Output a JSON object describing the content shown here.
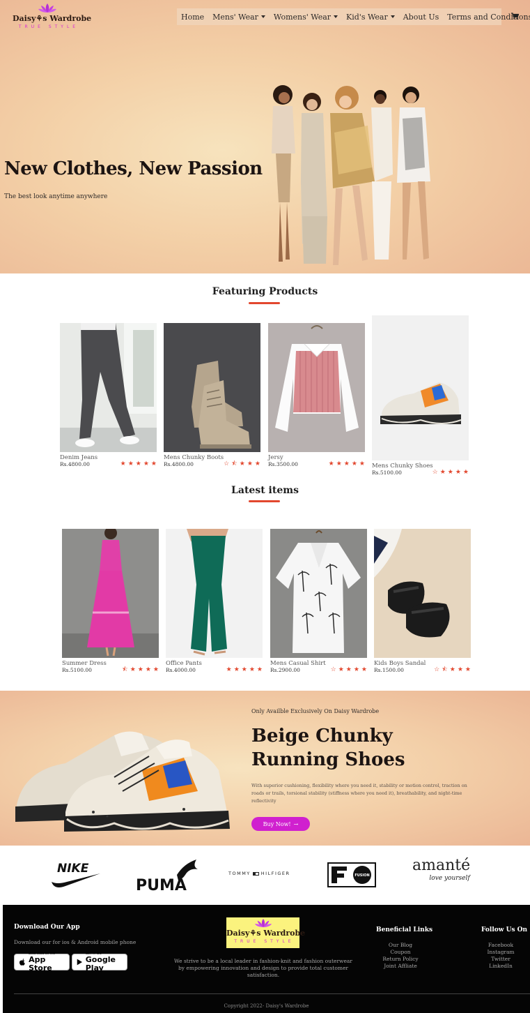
{
  "header": {
    "brand": "Daisy⚘s Wardrobe",
    "tagline": "TRUE STYLE",
    "nav": [
      {
        "label": "Home"
      },
      {
        "label": "Mens' Wear"
      },
      {
        "label": "Womens' Wear"
      },
      {
        "label": "Kid's Wear"
      },
      {
        "label": "About Us"
      },
      {
        "label": "Terms and Conditions"
      }
    ],
    "cart_icon": "cart-icon"
  },
  "hero": {
    "title": "New Clothes, New Passion",
    "subtitle": "The best look anytime anywhere"
  },
  "featuring": {
    "title": "Featuring Products",
    "items": [
      {
        "name": "Denim Jeans",
        "price": "Rs.4800.00",
        "rating": 5
      },
      {
        "name": "Mens Chunky Boots",
        "price": "Rs.4800.00",
        "rating": 3.5
      },
      {
        "name": "Jersy",
        "price": "Rs.3500.00",
        "rating": 5
      },
      {
        "name": "Mens Chunky Shoes",
        "price": "Rs.5100.00",
        "rating": 4
      }
    ]
  },
  "latest": {
    "title": "Latest items",
    "items": [
      {
        "name": "Summer Dress",
        "price": "Rs.5100.00",
        "rating": 4.5
      },
      {
        "name": "Office Pants",
        "price": "Rs.4000.00",
        "rating": 5
      },
      {
        "name": "Mens Casual Shirt",
        "price": "Rs.2900.00",
        "rating": 4
      },
      {
        "name": "Kids Boys Sandal",
        "price": "Rs.1500.00",
        "rating": 3.5
      }
    ]
  },
  "promo": {
    "eyebrow": "Only Availble Exclusively On Daisy Wardrobe",
    "title": "Beige Chunky Running Shoes",
    "description": "With superior cushioning, flexibility where you need it, stability or motion control, traction on roads or trails, torsional stability (stiffness where you need it), breathability, and night-time reflectivity",
    "button": "Buy Now!"
  },
  "brands": {
    "nike": "NIKE",
    "puma": "PUMA",
    "tommy_left": "TOMMY",
    "tommy_right": "HILFIGER",
    "fila": "FUSION",
    "amante": "amanté",
    "amante_tag": "love yourself"
  },
  "footer": {
    "app_title": "Download Our App",
    "app_desc": "Download our for ios & Android mobile phone",
    "appstore_small": "Download on the",
    "appstore_big": "App Store",
    "googleplay_small": "GET IT ON",
    "googleplay_big": "Google Play",
    "mission": "We strive to be a local leader in fashion-knit and fashion outerwear by empowering innovation and design to provide total customer satisfaction.",
    "links_title": "Beneficial Links",
    "links": [
      "Our Blog",
      "Coupon",
      "Return Policy",
      "Joint Affliate"
    ],
    "follow_title": "Follow Us On",
    "social": [
      "Facebook",
      "Instagram",
      "Twitter",
      "LinkedIn"
    ],
    "copyright": "Copyright 2022- Daisy's Wardrobe"
  },
  "colors": {
    "accent": "#e2472e",
    "brand_pink": "#d020cf",
    "hero_bg": "#f3cfa6",
    "footer_bg": "#050505"
  }
}
